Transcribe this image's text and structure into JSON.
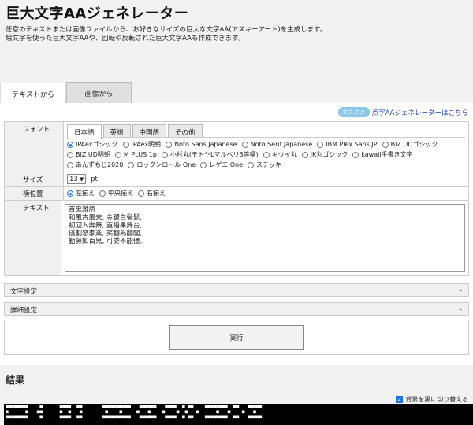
{
  "header": {
    "title": "巨大文字AAジェネレーター",
    "desc1": "任意のテキストまたは画像ファイルから、お好きなサイズの巨大な文字AA(アスキーアート)を生成します。",
    "desc2": "絵文字を使った巨大文字AAや、回転や反転された巨大文字AAも作成できます。"
  },
  "tabs": {
    "text": "テキストから",
    "image": "画像から"
  },
  "promo": {
    "badge": "オススメ",
    "link": "点字AAジェネレーターはこちら"
  },
  "form": {
    "font_label": "フォント",
    "font_tabs": [
      "日本語",
      "英語",
      "中国語",
      "その他"
    ],
    "fonts": [
      "IPAexゴシック",
      "IPAex明朝",
      "Noto Sans Japanese",
      "Noto Serif Japanese",
      "IBM Plex Sans JP",
      "BIZ UDゴシック",
      "BIZ UD明朝",
      "M PLUS 1p",
      "小杉丸(モトヤLマルベリ3等幅)",
      "キウイ丸",
      "JK丸ゴシック",
      "kawaii手書き文字",
      "あんずもじ2020",
      "ロックンロール One",
      "レゲエ One",
      "ステッキ"
    ],
    "selected_font": "IPAexゴシック",
    "size_label": "サイズ",
    "size_value": "13",
    "size_unit": "pt",
    "align_label": "横位置",
    "aligns": [
      "左揃え",
      "中央揃え",
      "右揃え"
    ],
    "selected_align": "左揃え",
    "text_label": "テキスト",
    "text_value": "百鬼雅語\n和風古風来, 金銀白髪髭,\n初回入奔舞, 直播果舞台,\n撲割怒家業, 笑翻為翻閣,\n勤勞如百鬼, 可愛不能僵。"
  },
  "sections": {
    "char_settings": "文字設定",
    "detail_settings": "詳細設定"
  },
  "run_label": "実行",
  "results": {
    "title": "結果",
    "bg_toggle": "背景を黒に切り替える",
    "bg_checked": true,
    "aa_text": "■■■■■■■■    ■      ■■■■  ■■       ■■■■■■■■■■   ■■■■■■   ■■■■  ■ ■■    ■■■■■■■■  ■■   ■■■■■\n■      ■   ■■      ■  ■   ■        ■    ■     ■   ■    ■    ■  ■   ■      ■   ■    ■   ■\n■■■■■■■■    ■      ■■■■  ■■       ■■■■■■■■■■   ■■■■■■   ■■■■  ■ ■■    ■■■■■■■■  ■■   ■■■■■"
  }
}
